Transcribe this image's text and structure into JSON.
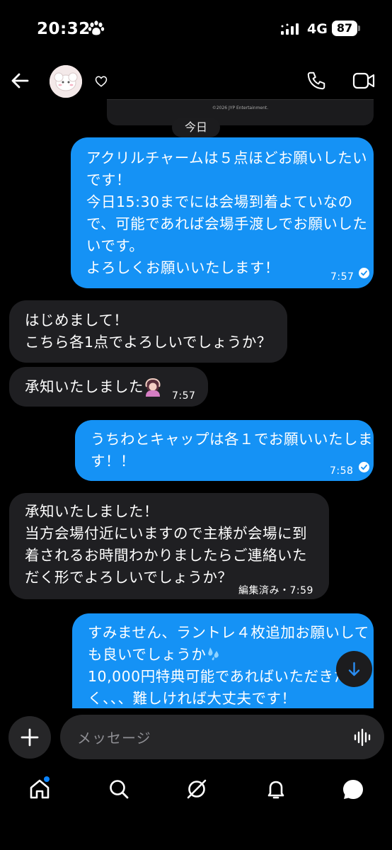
{
  "status_bar": {
    "time": "20:32",
    "network": "4G",
    "battery": "87"
  },
  "header": {
    "avatar_alt": "profile"
  },
  "media": {
    "caption": "©2026 JYP Entertainment."
  },
  "day_separator": "今日",
  "messages": [
    {
      "dir": "out",
      "lines": [
        "アクリルチャームは５点ほどお願いしたい",
        "です！",
        "今日15:30までには会場到着よていなの",
        "で、可能であれば会場手渡しでお願いした",
        "いです。",
        "よろしくお願いいたします！"
      ],
      "time": "7:57"
    },
    {
      "dir": "in",
      "lines": [
        "はじめまして！",
        "こちら各1点でよろしいでしょうか？"
      ]
    },
    {
      "dir": "in",
      "lines": [
        "承知いたしました"
      ],
      "time": "7:57"
    },
    {
      "dir": "out",
      "lines": [
        "うちわとキャップは各１でお願いいたしま",
        "す！！"
      ],
      "time": "7:58"
    },
    {
      "dir": "in",
      "lines": [
        "承知いたしました！",
        "当方会場付近にいますので主様が会場に到",
        "着されるお時間わかりましたらご連絡いた",
        "だく形でよろしいでしょうか？"
      ],
      "time": "編集済み・7:59"
    },
    {
      "dir": "out",
      "lines": [
        "すみません、ラントレ４枚追加お願いして",
        "も良いでしょうか",
        "10,000円特典可能であればいただきた",
        "く、、、難しければ大丈夫です！"
      ]
    }
  ],
  "composer": {
    "placeholder": "メッセージ"
  },
  "colors": {
    "outgoing": "#1592f5",
    "incoming": "#1f1f22",
    "background": "#000000",
    "input": "#262628"
  },
  "icons": [
    "back-arrow-icon",
    "heart-icon",
    "phone-icon",
    "video-icon",
    "plus-icon",
    "voice-wave-icon",
    "home-icon",
    "search-icon",
    "explore-icon",
    "bell-icon",
    "chat-icon",
    "arrow-down-icon"
  ]
}
